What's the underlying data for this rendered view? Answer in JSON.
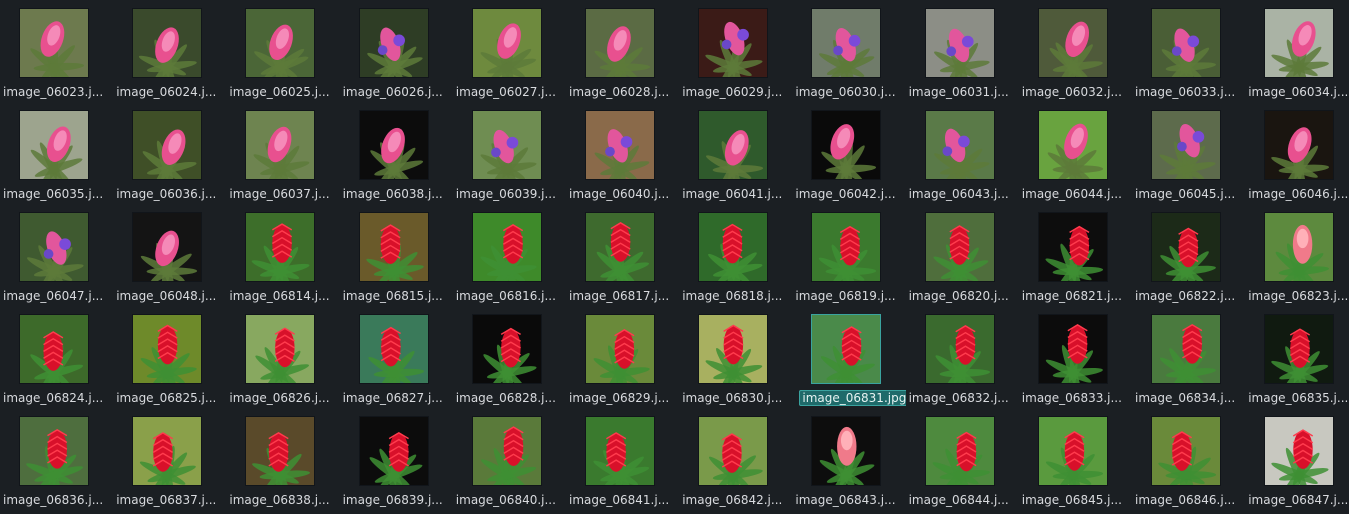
{
  "view": {
    "background": "#1b1f23",
    "selection_color": "#1f6a6a",
    "items": [
      {
        "label": "image_06023.j...",
        "theme": "pink-bromeliad",
        "bg": "#6d7a4e",
        "selected": false
      },
      {
        "label": "image_06024.j...",
        "theme": "pink-bromeliad",
        "bg": "#3a4a2c",
        "selected": false
      },
      {
        "label": "image_06025.j...",
        "theme": "pink-bromeliad",
        "bg": "#4b6637",
        "selected": false
      },
      {
        "label": "image_06026.j...",
        "theme": "purple-tillandsia",
        "bg": "#2e3d25",
        "selected": false
      },
      {
        "label": "image_06027.j...",
        "theme": "pink-bromeliad",
        "bg": "#6e8a3e",
        "selected": false
      },
      {
        "label": "image_06028.j...",
        "theme": "pink-bromeliad",
        "bg": "#5b6b44",
        "selected": false
      },
      {
        "label": "image_06029.j...",
        "theme": "purple-tillandsia",
        "bg": "#3b1b17",
        "selected": false
      },
      {
        "label": "image_06030.j...",
        "theme": "purple-tillandsia",
        "bg": "#707c6a",
        "selected": false
      },
      {
        "label": "image_06031.j...",
        "theme": "purple-tillandsia",
        "bg": "#8c8e86",
        "selected": false
      },
      {
        "label": "image_06032.j...",
        "theme": "pink-bromeliad",
        "bg": "#4f5a3a",
        "selected": false
      },
      {
        "label": "image_06033.j...",
        "theme": "purple-tillandsia",
        "bg": "#4a5e36",
        "selected": false
      },
      {
        "label": "image_06034.j...",
        "theme": "pink-bromeliad",
        "bg": "#aab3a5",
        "selected": false
      },
      {
        "label": "image_06035.j...",
        "theme": "pink-bromeliad",
        "bg": "#9da48e",
        "selected": false
      },
      {
        "label": "image_06036.j...",
        "theme": "pink-bromeliad",
        "bg": "#3f4f27",
        "selected": false
      },
      {
        "label": "image_06037.j...",
        "theme": "pink-bromeliad",
        "bg": "#6e8450",
        "selected": false
      },
      {
        "label": "image_06038.j...",
        "theme": "pink-bromeliad",
        "bg": "#0c0c0c",
        "selected": false
      },
      {
        "label": "image_06039.j...",
        "theme": "purple-tillandsia",
        "bg": "#6f8d52",
        "selected": false
      },
      {
        "label": "image_06040.j...",
        "theme": "purple-tillandsia",
        "bg": "#8a6a4a",
        "selected": false
      },
      {
        "label": "image_06041.j...",
        "theme": "pink-bromeliad",
        "bg": "#2f5a2c",
        "selected": false
      },
      {
        "label": "image_06042.j...",
        "theme": "pink-bromeliad",
        "bg": "#0a0a0a",
        "selected": false
      },
      {
        "label": "image_06043.j...",
        "theme": "purple-tillandsia",
        "bg": "#5a7a48",
        "selected": false
      },
      {
        "label": "image_06044.j...",
        "theme": "pink-bromeliad",
        "bg": "#69a33f",
        "selected": false
      },
      {
        "label": "image_06045.j...",
        "theme": "purple-tillandsia",
        "bg": "#5d6b4c",
        "selected": false
      },
      {
        "label": "image_06046.j...",
        "theme": "pink-bromeliad",
        "bg": "#1a1510",
        "selected": false
      },
      {
        "label": "image_06047.j...",
        "theme": "purple-tillandsia",
        "bg": "#3f5a30",
        "selected": false
      },
      {
        "label": "image_06048.j...",
        "theme": "pink-bromeliad",
        "bg": "#141414",
        "selected": false
      },
      {
        "label": "image_06814.j...",
        "theme": "red-ginger",
        "bg": "#3d6e2a",
        "selected": false
      },
      {
        "label": "image_06815.j...",
        "theme": "red-ginger",
        "bg": "#6a5a2a",
        "selected": false
      },
      {
        "label": "image_06816.j...",
        "theme": "red-ginger",
        "bg": "#3e8a2a",
        "selected": false
      },
      {
        "label": "image_06817.j...",
        "theme": "red-ginger",
        "bg": "#3e6a2e",
        "selected": false
      },
      {
        "label": "image_06818.j...",
        "theme": "red-ginger",
        "bg": "#2f6a2a",
        "selected": false
      },
      {
        "label": "image_06819.j...",
        "theme": "red-ginger",
        "bg": "#3b7a2e",
        "selected": false
      },
      {
        "label": "image_06820.j...",
        "theme": "red-ginger",
        "bg": "#4f6e3c",
        "selected": false
      },
      {
        "label": "image_06821.j...",
        "theme": "red-ginger",
        "bg": "#0d0d0d",
        "selected": false
      },
      {
        "label": "image_06822.j...",
        "theme": "red-ginger",
        "bg": "#1c2a18",
        "selected": false
      },
      {
        "label": "image_06823.j...",
        "theme": "pink-ginger",
        "bg": "#5d8a3e",
        "selected": false
      },
      {
        "label": "image_06824.j...",
        "theme": "red-ginger",
        "bg": "#3d6a2a",
        "selected": false
      },
      {
        "label": "image_06825.j...",
        "theme": "red-ginger",
        "bg": "#6e8a2a",
        "selected": false
      },
      {
        "label": "image_06826.j...",
        "theme": "red-ginger",
        "bg": "#88a860",
        "selected": false
      },
      {
        "label": "image_06827.j...",
        "theme": "red-ginger",
        "bg": "#3a7a5a",
        "selected": false
      },
      {
        "label": "image_06828.j...",
        "theme": "red-ginger",
        "bg": "#0a0a0a",
        "selected": false
      },
      {
        "label": "image_06829.j...",
        "theme": "red-ginger",
        "bg": "#6a8a3a",
        "selected": false
      },
      {
        "label": "image_06830.j...",
        "theme": "red-ginger",
        "bg": "#a8b060",
        "selected": false
      },
      {
        "label": "image_06831.jpg",
        "theme": "red-ginger",
        "bg": "#4a8a4a",
        "selected": true
      },
      {
        "label": "image_06832.j...",
        "theme": "red-ginger",
        "bg": "#3a6a2e",
        "selected": false
      },
      {
        "label": "image_06833.j...",
        "theme": "red-ginger",
        "bg": "#0c0c0c",
        "selected": false
      },
      {
        "label": "image_06834.j...",
        "theme": "red-ginger",
        "bg": "#4a7a3e",
        "selected": false
      },
      {
        "label": "image_06835.j...",
        "theme": "red-ginger",
        "bg": "#101a10",
        "selected": false
      },
      {
        "label": "image_06836.j...",
        "theme": "red-ginger",
        "bg": "#4e6e3e",
        "selected": false
      },
      {
        "label": "image_06837.j...",
        "theme": "red-ginger",
        "bg": "#8aa04a",
        "selected": false
      },
      {
        "label": "image_06838.j...",
        "theme": "red-ginger",
        "bg": "#5a4a2a",
        "selected": false
      },
      {
        "label": "image_06839.j...",
        "theme": "red-ginger",
        "bg": "#0c0c0c",
        "selected": false
      },
      {
        "label": "image_06840.j...",
        "theme": "red-ginger",
        "bg": "#5a7a3a",
        "selected": false
      },
      {
        "label": "image_06841.j...",
        "theme": "red-ginger",
        "bg": "#3a7a2e",
        "selected": false
      },
      {
        "label": "image_06842.j...",
        "theme": "red-ginger",
        "bg": "#7a9a4a",
        "selected": false
      },
      {
        "label": "image_06843.j...",
        "theme": "pink-ginger",
        "bg": "#0d0d0d",
        "selected": false
      },
      {
        "label": "image_06844.j...",
        "theme": "red-ginger",
        "bg": "#4e8a3e",
        "selected": false
      },
      {
        "label": "image_06845.j...",
        "theme": "red-ginger",
        "bg": "#5a9a3e",
        "selected": false
      },
      {
        "label": "image_06846.j...",
        "theme": "red-ginger",
        "bg": "#6a8a3a",
        "selected": false
      },
      {
        "label": "image_06847.j...",
        "theme": "red-ginger",
        "bg": "#c8c8c0",
        "selected": false
      }
    ]
  }
}
